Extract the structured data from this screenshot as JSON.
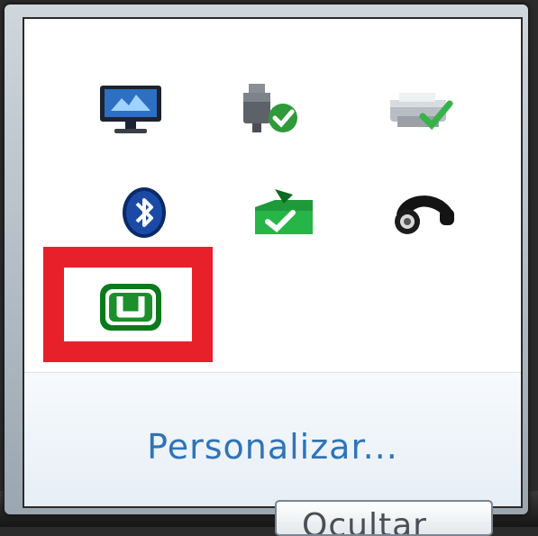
{
  "tray_overflow": {
    "customize_label": "Personalizar...",
    "tooltip_label": "Ocultar",
    "highlight_color": "#e8202a",
    "link_color": "#2f74b8",
    "icons": [
      {
        "name": "display-monitor-icon"
      },
      {
        "name": "usb-device-ok-icon"
      },
      {
        "name": "printer-ok-icon"
      },
      {
        "name": "bluetooth-icon"
      },
      {
        "name": "green-folder-sync-icon"
      },
      {
        "name": "headset-icon"
      },
      {
        "name": "utorrent-icon",
        "highlighted": true
      }
    ]
  }
}
